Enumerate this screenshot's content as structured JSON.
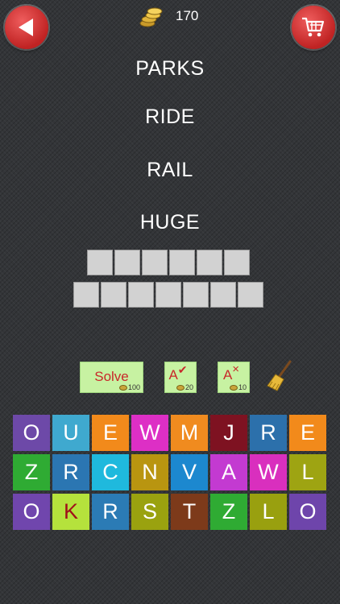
{
  "header": {
    "back_icon": "back-arrow-icon",
    "coins_icon": "gold-coins-icon",
    "coins": "170",
    "cart_icon": "shopping-cart-icon"
  },
  "clues": [
    "PARKS",
    "RIDE",
    "RAIL",
    "HUGE"
  ],
  "answer": {
    "row1_length": 6,
    "row2_length": 7
  },
  "hints": {
    "solve": {
      "label": "Solve",
      "cost": "100"
    },
    "reveal": {
      "label": "A",
      "mark": "✔",
      "cost": "20"
    },
    "remove": {
      "label": "A",
      "mark": "×",
      "cost": "10"
    },
    "broom_icon": "broom-icon"
  },
  "keyboard": {
    "rows": [
      [
        {
          "letter": "O",
          "color": "#6d49a8"
        },
        {
          "letter": "U",
          "color": "#3fa9cf"
        },
        {
          "letter": "E",
          "color": "#f28a1b"
        },
        {
          "letter": "W",
          "color": "#dd2fc5"
        },
        {
          "letter": "M",
          "color": "#f08b1f"
        },
        {
          "letter": "J",
          "color": "#7e1221"
        },
        {
          "letter": "R",
          "color": "#2c70ab"
        },
        {
          "letter": "E",
          "color": "#f28a1b"
        }
      ],
      [
        {
          "letter": "Z",
          "color": "#2fab33"
        },
        {
          "letter": "R",
          "color": "#2b76b2"
        },
        {
          "letter": "C",
          "color": "#1fb9dd"
        },
        {
          "letter": "N",
          "color": "#b99510"
        },
        {
          "letter": "V",
          "color": "#1c88cf"
        },
        {
          "letter": "A",
          "color": "#c33ad1"
        },
        {
          "letter": "W",
          "color": "#d92fbe"
        },
        {
          "letter": "L",
          "color": "#9ea412"
        }
      ],
      [
        {
          "letter": "O",
          "color": "#7046ad"
        },
        {
          "letter": "K",
          "color": "#b5e23c",
          "text": "#a0101a"
        },
        {
          "letter": "R",
          "color": "#2b7bb5"
        },
        {
          "letter": "S",
          "color": "#9aa20f"
        },
        {
          "letter": "T",
          "color": "#7d3a1a"
        },
        {
          "letter": "Z",
          "color": "#2fab33"
        },
        {
          "letter": "L",
          "color": "#99a00f"
        },
        {
          "letter": "O",
          "color": "#6e45ab"
        }
      ]
    ]
  }
}
